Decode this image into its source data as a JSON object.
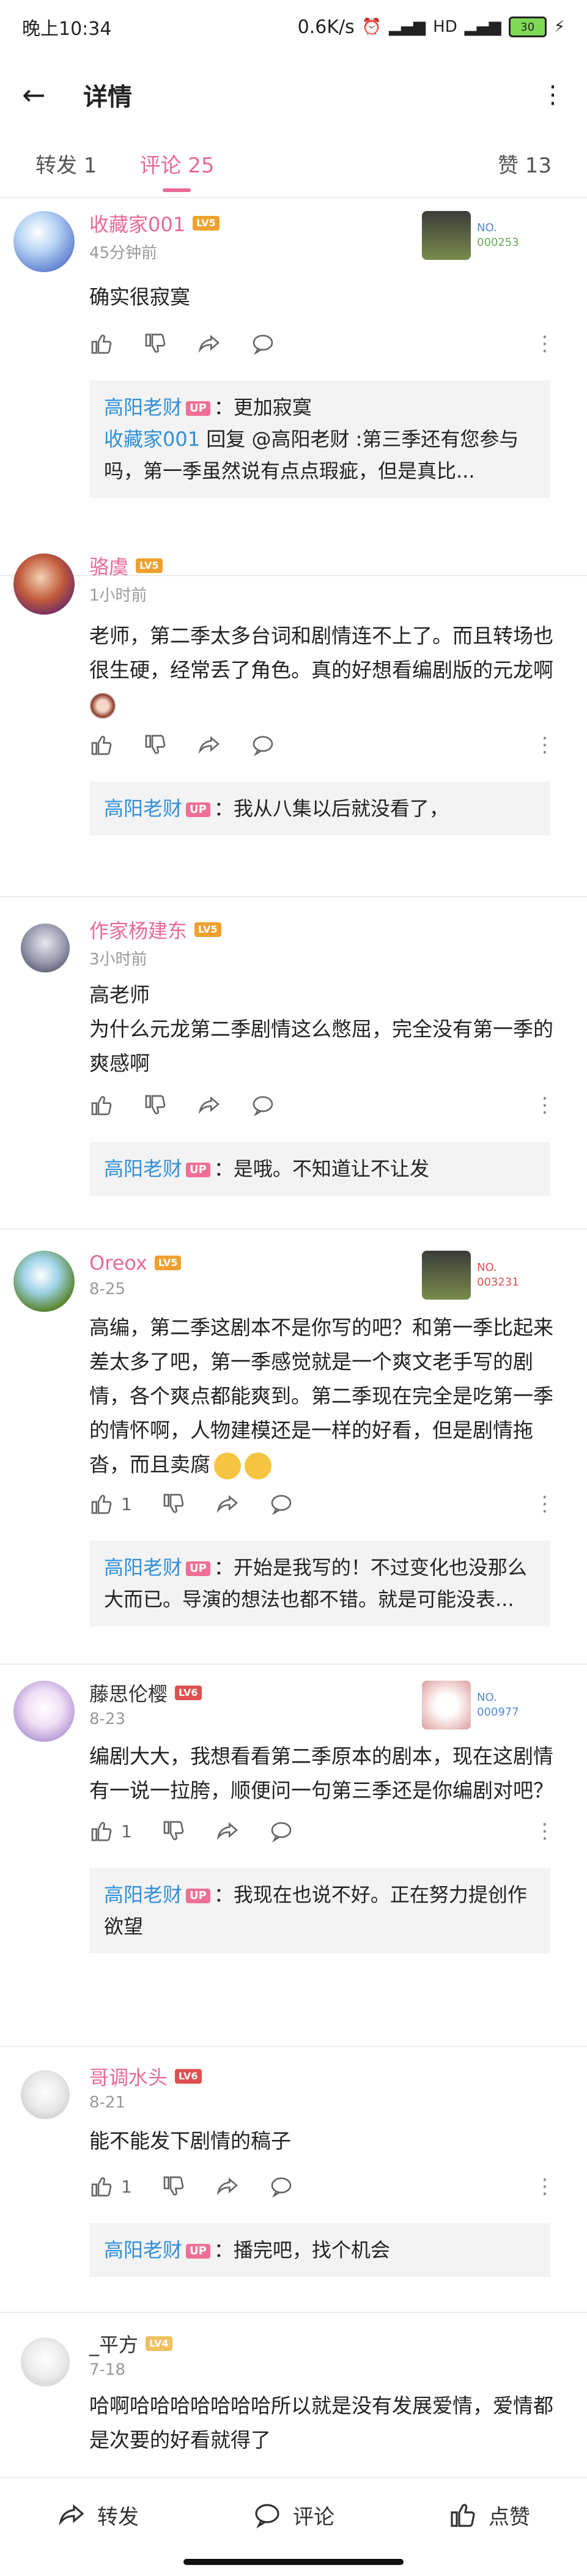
{
  "status": {
    "time": "晚上10:34",
    "speed": "0.6K/s",
    "network": "3G 4G HD",
    "battery": "30"
  },
  "header": {
    "title": "详情"
  },
  "tabs": [
    {
      "label": "转发 1"
    },
    {
      "label": "评论 25"
    },
    {
      "label": "赞 13"
    }
  ],
  "comments": [
    {
      "name": "收藏家001",
      "level": "LV5",
      "time": "45分钟前",
      "text": "确实很寂寞",
      "badge_no": "000253",
      "likes": "",
      "replies": [
        {
          "name": "高阳老财",
          "text": "更加寂寞"
        },
        {
          "name": "收藏家001",
          "text": "回复 @高阳老财 :第三季还有您参与吗，第一季虽然说有点点瑕疵，但是真比..."
        }
      ]
    },
    {
      "name": "骆虞",
      "level": "LV5",
      "time": "1小时前",
      "text": "老师，第二季太多台词和剧情连不上了。而且转场也很生硬，经常丢了角色。真的好想看编剧版的元龙啊",
      "likes": "",
      "replies": [
        {
          "name": "高阳老财",
          "text": "我从八集以后就没看了，"
        }
      ]
    },
    {
      "name": "作家杨建东",
      "level": "LV5",
      "time": "3小时前",
      "text": "高老师\n为什么元龙第二季剧情这么憋屈，完全没有第一季的爽感啊",
      "likes": "",
      "replies": [
        {
          "name": "高阳老财",
          "text": "是哦。不知道让不让发"
        }
      ]
    },
    {
      "name": "Oreox",
      "level": "LV5",
      "time": "8-25",
      "text": "高编，第二季这剧本不是你写的吧？和第一季比起来差太多了吧，第一季感觉就是一个爽文老手写的剧情，各个爽点都能爽到。第二季现在完全是吃第一季的情怀啊，人物建模还是一样的好看，但是剧情拖沓，而且卖腐",
      "badge_no": "003231",
      "likes": "1",
      "replies": [
        {
          "name": "高阳老财",
          "text": "开始是我写的！不过变化也没那么大而已。导演的想法也都不错。就是可能没表..."
        }
      ]
    },
    {
      "name": "藤思伦樱",
      "level": "LV6",
      "time": "8-23",
      "text": "编剧大大，我想看看第二季原本的剧本，现在这剧情有一说一拉胯，顺便问一句第三季还是你编剧对吧？",
      "badge_no": "000977",
      "likes": "1",
      "replies": [
        {
          "name": "高阳老财",
          "text": "我现在也说不好。正在努力提创作欲望"
        }
      ]
    },
    {
      "name": "哥调水头",
      "level": "LV6",
      "time": "8-21",
      "text": "能不能发下剧情的稿子",
      "likes": "1",
      "replies": [
        {
          "name": "高阳老财",
          "text": "播完吧，找个机会"
        }
      ]
    },
    {
      "name": "_平方",
      "level": "LV4",
      "time": "7-18",
      "text": "哈啊哈哈哈哈哈哈哈所以就是没有发展爱情，爱情都是次要的好看就得了",
      "likes": ""
    }
  ],
  "labels": {
    "no_prefix": "NO."
  },
  "bottom": {
    "forward": "转发",
    "comment": "评论",
    "like": "点赞"
  },
  "colors": {
    "accent": "#e86a92",
    "link": "#2f8fd8",
    "lv5": "#f0a030",
    "lv6": "#e05050"
  }
}
